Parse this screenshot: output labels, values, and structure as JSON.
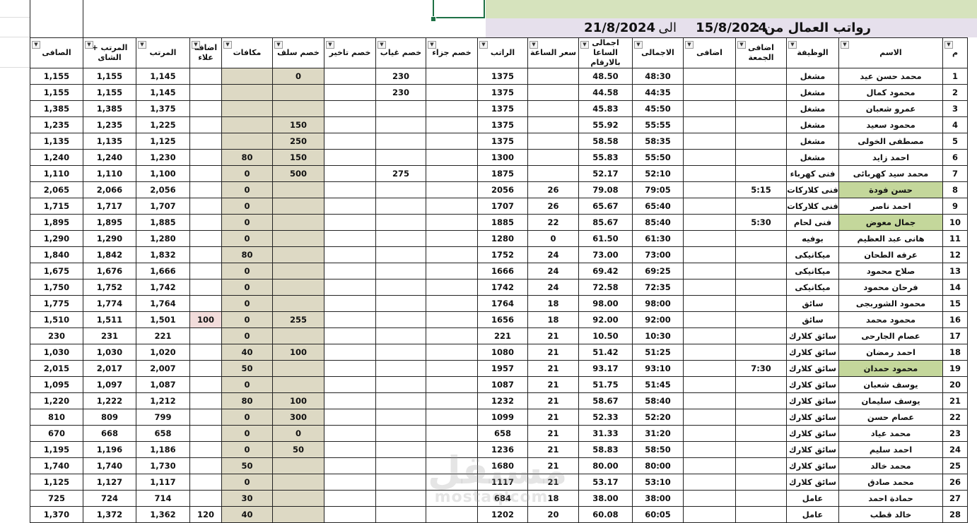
{
  "sheet": {
    "title": {
      "label": "رواتب العمال من :",
      "from_date": "15/8/2024",
      "to_label": "الى",
      "to_date": "21/8/2024"
    },
    "headers": {
      "m": "م",
      "name": "الاسم",
      "job": "الوظيفة",
      "friday_extra": "اضافى الجمعة",
      "extra": "اضافى",
      "total": "الاجمالى",
      "total_hours_num": "اجمالى الساعا بالارقام",
      "hour_price": "سعر الساعة",
      "salary": "الراتب",
      "part_deduct": "خصم جزاء",
      "absence_deduct": "خصم غياب",
      "late_deduct": "خصم تاخير",
      "advance_deduct": "خصم سلف",
      "bonuses": "مكافات",
      "extra_alaa": "اضافة علاء",
      "net_salary": "المرتب",
      "salary_tea": "المرتب + الشاى",
      "final_net": "الصافى"
    },
    "rows": [
      {
        "m": "1",
        "name": "محمد حسن عيد",
        "job": "مشغل",
        "fri": "",
        "extra": "",
        "total": "48:30",
        "hours": "48.50",
        "price": "",
        "salary": "1375",
        "part": "",
        "absence": "230",
        "late": "",
        "advance": "0",
        "bonus": "",
        "alaa": "",
        "net": "1,145",
        "tea": "1,155",
        "final": "1,155",
        "hl": ""
      },
      {
        "m": "2",
        "name": "محمود كمال",
        "job": "مشغل",
        "fri": "",
        "extra": "",
        "total": "44:35",
        "hours": "44.58",
        "price": "",
        "salary": "1375",
        "part": "",
        "absence": "230",
        "late": "",
        "advance": "",
        "bonus": "",
        "alaa": "",
        "net": "1,145",
        "tea": "1,155",
        "final": "1,155",
        "hl": ""
      },
      {
        "m": "3",
        "name": "عمرو شعبان",
        "job": "مشغل",
        "fri": "",
        "extra": "",
        "total": "45:50",
        "hours": "45.83",
        "price": "",
        "salary": "1375",
        "part": "",
        "absence": "",
        "late": "",
        "advance": "",
        "bonus": "",
        "alaa": "",
        "net": "1,375",
        "tea": "1,385",
        "final": "1,385",
        "hl": ""
      },
      {
        "m": "4",
        "name": "محمود سعيد",
        "job": "مشغل",
        "fri": "",
        "extra": "",
        "total": "55:55",
        "hours": "55.92",
        "price": "",
        "salary": "1375",
        "part": "",
        "absence": "",
        "late": "",
        "advance": "150",
        "bonus": "",
        "alaa": "",
        "net": "1,225",
        "tea": "1,235",
        "final": "1,235",
        "hl": ""
      },
      {
        "m": "5",
        "name": "مصطفى الخولى",
        "job": "مشغل",
        "fri": "",
        "extra": "",
        "total": "58:35",
        "hours": "58.58",
        "price": "",
        "salary": "1375",
        "part": "",
        "absence": "",
        "late": "",
        "advance": "250",
        "bonus": "",
        "alaa": "",
        "net": "1,125",
        "tea": "1,135",
        "final": "1,135",
        "hl": ""
      },
      {
        "m": "6",
        "name": "احمد زايد",
        "job": "مشغل",
        "fri": "",
        "extra": "",
        "total": "55:50",
        "hours": "55.83",
        "price": "",
        "salary": "1300",
        "part": "",
        "absence": "",
        "late": "",
        "advance": "150",
        "bonus": "80",
        "alaa": "",
        "net": "1,230",
        "tea": "1,240",
        "final": "1,240",
        "hl": ""
      },
      {
        "m": "7",
        "name": "محمد سيد كهربائى",
        "job": "فنى كهرباء",
        "fri": "",
        "extra": "",
        "total": "52:10",
        "hours": "52.17",
        "price": "",
        "salary": "1875",
        "part": "",
        "absence": "275",
        "late": "",
        "advance": "500",
        "bonus": "0",
        "alaa": "",
        "net": "1,100",
        "tea": "1,110",
        "final": "1,110",
        "hl": ""
      },
      {
        "m": "8",
        "name": "حسن فودة",
        "job": "فنى كلاركات",
        "fri": "5:15",
        "extra": "",
        "total": "79:05",
        "hours": "79.08",
        "price": "26",
        "salary": "2056",
        "part": "",
        "absence": "",
        "late": "",
        "advance": "",
        "bonus": "0",
        "alaa": "",
        "net": "2,056",
        "tea": "2,066",
        "final": "2,065",
        "hl": "green"
      },
      {
        "m": "9",
        "name": "احمد ناصر",
        "job": "فنى كلاركات",
        "fri": "",
        "extra": "",
        "total": "65:40",
        "hours": "65.67",
        "price": "26",
        "salary": "1707",
        "part": "",
        "absence": "",
        "late": "",
        "advance": "",
        "bonus": "0",
        "alaa": "",
        "net": "1,707",
        "tea": "1,717",
        "final": "1,715",
        "hl": ""
      },
      {
        "m": "10",
        "name": "جمال معوض",
        "job": "فنى لحام",
        "fri": "5:30",
        "extra": "",
        "total": "85:40",
        "hours": "85.67",
        "price": "22",
        "salary": "1885",
        "part": "",
        "absence": "",
        "late": "",
        "advance": "",
        "bonus": "0",
        "alaa": "",
        "net": "1,885",
        "tea": "1,895",
        "final": "1,895",
        "hl": "green"
      },
      {
        "m": "11",
        "name": "هانى عبد العظيم",
        "job": "بوفيه",
        "fri": "",
        "extra": "",
        "total": "61:30",
        "hours": "61.50",
        "price": "0",
        "salary": "1280",
        "part": "",
        "absence": "",
        "late": "",
        "advance": "",
        "bonus": "0",
        "alaa": "",
        "net": "1,280",
        "tea": "1,290",
        "final": "1,290",
        "hl": ""
      },
      {
        "m": "12",
        "name": "عرفه الطحان",
        "job": "ميكانيكى",
        "fri": "",
        "extra": "",
        "total": "73:00",
        "hours": "73.00",
        "price": "24",
        "salary": "1752",
        "part": "",
        "absence": "",
        "late": "",
        "advance": "",
        "bonus": "80",
        "alaa": "",
        "net": "1,832",
        "tea": "1,842",
        "final": "1,840",
        "hl": ""
      },
      {
        "m": "13",
        "name": "صلاح محمود",
        "job": "ميكانيكى",
        "fri": "",
        "extra": "",
        "total": "69:25",
        "hours": "69.42",
        "price": "24",
        "salary": "1666",
        "part": "",
        "absence": "",
        "late": "",
        "advance": "",
        "bonus": "0",
        "alaa": "",
        "net": "1,666",
        "tea": "1,676",
        "final": "1,675",
        "hl": ""
      },
      {
        "m": "14",
        "name": "فرحان محمود",
        "job": "ميكانيكى",
        "fri": "",
        "extra": "",
        "total": "72:35",
        "hours": "72.58",
        "price": "24",
        "salary": "1742",
        "part": "",
        "absence": "",
        "late": "",
        "advance": "",
        "bonus": "0",
        "alaa": "",
        "net": "1,742",
        "tea": "1,752",
        "final": "1,750",
        "hl": ""
      },
      {
        "m": "15",
        "name": "محمود الشوربجى",
        "job": "سائق",
        "fri": "",
        "extra": "",
        "total": "98:00",
        "hours": "98.00",
        "price": "18",
        "salary": "1764",
        "part": "",
        "absence": "",
        "late": "",
        "advance": "",
        "bonus": "0",
        "alaa": "",
        "net": "1,764",
        "tea": "1,774",
        "final": "1,775",
        "hl": ""
      },
      {
        "m": "16",
        "name": "محمود محمد",
        "job": "سائق",
        "fri": "",
        "extra": "",
        "total": "92:00",
        "hours": "92.00",
        "price": "18",
        "salary": "1656",
        "part": "",
        "absence": "",
        "late": "",
        "advance": "255",
        "bonus": "0",
        "alaa": "100",
        "net": "1,501",
        "tea": "1,511",
        "final": "1,510",
        "hl": ""
      },
      {
        "m": "17",
        "name": "عصام الجارحى",
        "job": "سائق كلارك",
        "fri": "",
        "extra": "",
        "total": "10:30",
        "hours": "10.50",
        "price": "21",
        "salary": "221",
        "part": "",
        "absence": "",
        "late": "",
        "advance": "",
        "bonus": "0",
        "alaa": "",
        "net": "221",
        "tea": "231",
        "final": "230",
        "hl": ""
      },
      {
        "m": "18",
        "name": "احمد رمضان",
        "job": "سائق كلارك",
        "fri": "",
        "extra": "",
        "total": "51:25",
        "hours": "51.42",
        "price": "21",
        "salary": "1080",
        "part": "",
        "absence": "",
        "late": "",
        "advance": "100",
        "bonus": "40",
        "alaa": "",
        "net": "1,020",
        "tea": "1,030",
        "final": "1,030",
        "hl": ""
      },
      {
        "m": "19",
        "name": "محمود حمدان",
        "job": "سائق كلارك",
        "fri": "7:30",
        "extra": "",
        "total": "93:10",
        "hours": "93.17",
        "price": "21",
        "salary": "1957",
        "part": "",
        "absence": "",
        "late": "",
        "advance": "",
        "bonus": "50",
        "alaa": "",
        "net": "2,007",
        "tea": "2,017",
        "final": "2,015",
        "hl": "green"
      },
      {
        "m": "20",
        "name": "يوسف شعبان",
        "job": "سائق كلارك",
        "fri": "",
        "extra": "",
        "total": "51:45",
        "hours": "51.75",
        "price": "21",
        "salary": "1087",
        "part": "",
        "absence": "",
        "late": "",
        "advance": "",
        "bonus": "0",
        "alaa": "",
        "net": "1,087",
        "tea": "1,097",
        "final": "1,095",
        "hl": ""
      },
      {
        "m": "21",
        "name": "يوسف سليمان",
        "job": "سائق كلارك",
        "fri": "",
        "extra": "",
        "total": "58:40",
        "hours": "58.67",
        "price": "21",
        "salary": "1232",
        "part": "",
        "absence": "",
        "late": "",
        "advance": "100",
        "bonus": "80",
        "alaa": "",
        "net": "1,212",
        "tea": "1,222",
        "final": "1,220",
        "hl": ""
      },
      {
        "m": "22",
        "name": "عصام حسن",
        "job": "سائق كلارك",
        "fri": "",
        "extra": "",
        "total": "52:20",
        "hours": "52.33",
        "price": "21",
        "salary": "1099",
        "part": "",
        "absence": "",
        "late": "",
        "advance": "300",
        "bonus": "0",
        "alaa": "",
        "net": "799",
        "tea": "809",
        "final": "810",
        "hl": ""
      },
      {
        "m": "23",
        "name": "محمد عياد",
        "job": "سائق كلارك",
        "fri": "",
        "extra": "",
        "total": "31:20",
        "hours": "31.33",
        "price": "21",
        "salary": "658",
        "part": "",
        "absence": "",
        "late": "",
        "advance": "0",
        "bonus": "0",
        "alaa": "",
        "net": "658",
        "tea": "668",
        "final": "670",
        "hl": ""
      },
      {
        "m": "24",
        "name": "احمد سليم",
        "job": "سائق كلارك",
        "fri": "",
        "extra": "",
        "total": "58:50",
        "hours": "58.83",
        "price": "21",
        "salary": "1236",
        "part": "",
        "absence": "",
        "late": "",
        "advance": "50",
        "bonus": "0",
        "alaa": "",
        "net": "1,186",
        "tea": "1,196",
        "final": "1,195",
        "hl": ""
      },
      {
        "m": "25",
        "name": "محمد خالد",
        "job": "سائق كلارك",
        "fri": "",
        "extra": "",
        "total": "80:00",
        "hours": "80.00",
        "price": "21",
        "salary": "1680",
        "part": "",
        "absence": "",
        "late": "",
        "advance": "",
        "bonus": "50",
        "alaa": "",
        "net": "1,730",
        "tea": "1,740",
        "final": "1,740",
        "hl": ""
      },
      {
        "m": "26",
        "name": "محمد صادق",
        "job": "سائق كلارك",
        "fri": "",
        "extra": "",
        "total": "53:10",
        "hours": "53.17",
        "price": "21",
        "salary": "1117",
        "part": "",
        "absence": "",
        "late": "",
        "advance": "",
        "bonus": "0",
        "alaa": "",
        "net": "1,117",
        "tea": "1,127",
        "final": "1,125",
        "hl": ""
      },
      {
        "m": "27",
        "name": "حمادة احمد",
        "job": "عامل",
        "fri": "",
        "extra": "",
        "total": "38:00",
        "hours": "38.00",
        "price": "18",
        "salary": "684",
        "part": "",
        "absence": "",
        "late": "",
        "advance": "",
        "bonus": "30",
        "alaa": "",
        "net": "714",
        "tea": "724",
        "final": "725",
        "hl": ""
      },
      {
        "m": "28",
        "name": "خالد قطب",
        "job": "عامل",
        "fri": "",
        "extra": "",
        "total": "60:05",
        "hours": "60.08",
        "price": "20",
        "salary": "1202",
        "part": "",
        "absence": "",
        "late": "",
        "advance": "",
        "bonus": "40",
        "alaa": "120",
        "net": "1,362",
        "tea": "1,372",
        "final": "1,370",
        "hl": ""
      }
    ],
    "watermark": {
      "arabic": "مستقل",
      "latin": "mostaqlcom"
    }
  }
}
